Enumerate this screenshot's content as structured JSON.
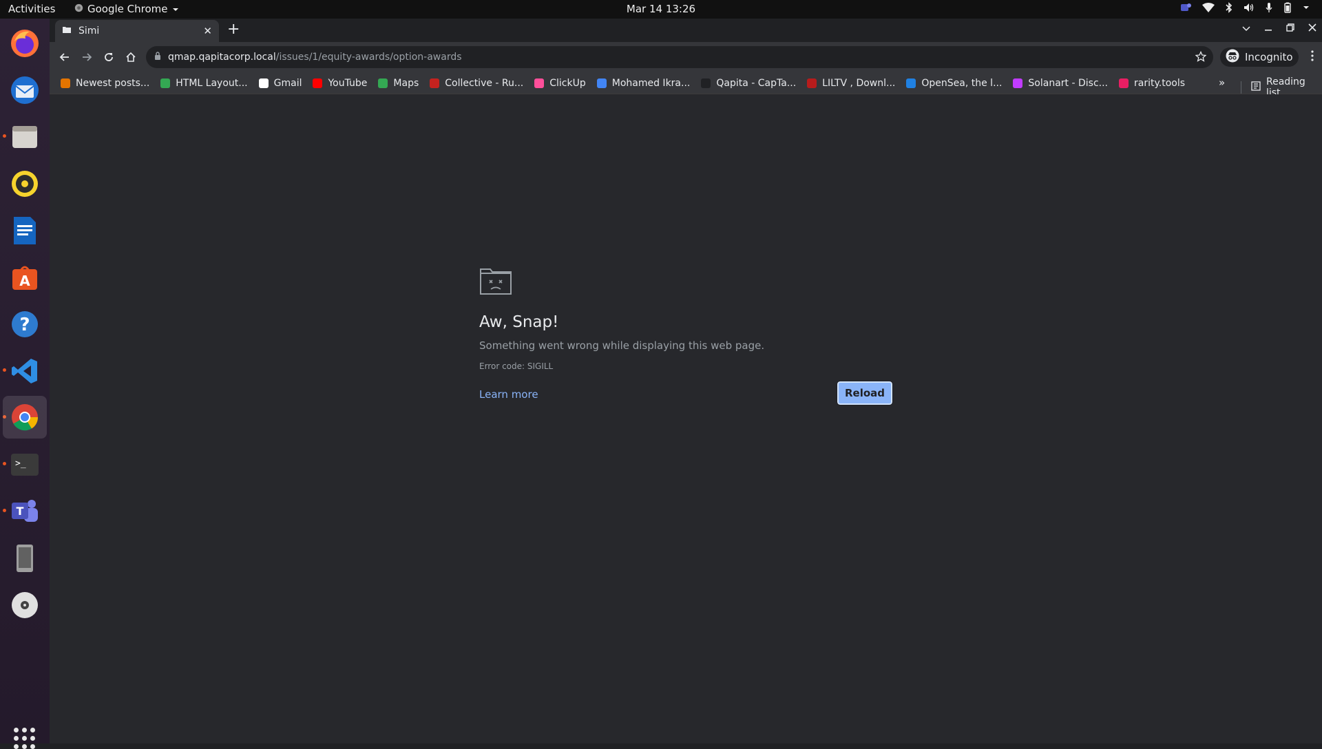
{
  "topbar": {
    "activities": "Activities",
    "app_name": "Google Chrome",
    "clock": "Mar 14  13:26"
  },
  "browser": {
    "tab_title": "Simi",
    "url_host": "qmap.qapitacorp.local",
    "url_path": "/issues/1/equity-awards/option-awards",
    "incognito_label": "Incognito"
  },
  "bookmarks": [
    {
      "label": "Newest posts...",
      "color": "#e37400"
    },
    {
      "label": "HTML Layout...",
      "color": "#34a853"
    },
    {
      "label": "Gmail",
      "color": "#ffffff"
    },
    {
      "label": "YouTube",
      "color": "#ff0000"
    },
    {
      "label": "Maps",
      "color": "#34a853"
    },
    {
      "label": "Collective - Ru...",
      "color": "#c5221f"
    },
    {
      "label": "ClickUp",
      "color": "#ff4f9a"
    },
    {
      "label": "Mohamed Ikra...",
      "color": "#4285f4"
    },
    {
      "label": "Qapita - CapTa...",
      "color": "#202124"
    },
    {
      "label": "LILTV , Downl...",
      "color": "#b71c1c"
    },
    {
      "label": "OpenSea, the l...",
      "color": "#2081e2"
    },
    {
      "label": "Solanart - Disc...",
      "color": "#c13cff"
    },
    {
      "label": "rarity.tools",
      "color": "#e91e63"
    }
  ],
  "bookmarks_more": "»",
  "reading_list": "Reading list",
  "error_page": {
    "title": "Aw, Snap!",
    "message": "Something went wrong while displaying this web page.",
    "error_code": "Error code: SIGILL",
    "learn_more": "Learn more",
    "reload_button": "Reload"
  },
  "dock_apps": [
    "firefox-icon",
    "thunderbird-icon",
    "files-icon",
    "rhythmbox-icon",
    "writer-icon",
    "software-icon",
    "help-icon",
    "vscode-icon",
    "chrome-icon",
    "terminal-icon",
    "teams-icon",
    "device-icon",
    "disc-icon"
  ],
  "colors": {
    "accent": "#8ab4f8",
    "page_bg": "#27282c",
    "toolbar_bg": "#35363a"
  }
}
